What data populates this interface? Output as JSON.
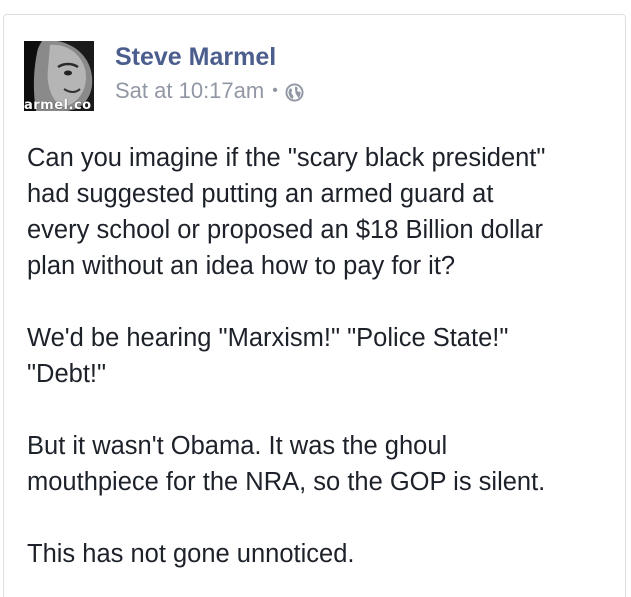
{
  "post": {
    "author": {
      "name": "Steve Marmel",
      "avatar_watermark": "armel.co"
    },
    "timestamp": "Sat at 10:17am",
    "separator": "•",
    "privacy_icon": "globe-icon",
    "paragraphs": [
      "Can you imagine if the \"scary black president\"\nhad suggested putting an armed guard at\nevery school or proposed an $18 Billion dollar\nplan without an idea how to pay for it?",
      "We'd be hearing \"Marxism!\" \"Police State!\"\n\"Debt!\"",
      "But it wasn't Obama.  It was the ghoul\nmouthpiece for the NRA, so the GOP is silent.",
      "This has not gone unnoticed."
    ]
  },
  "colors": {
    "author_name": "#4b5e8d",
    "meta_text": "#9197a3",
    "body_text": "#1d2129",
    "card_border": "#dddfe2"
  }
}
